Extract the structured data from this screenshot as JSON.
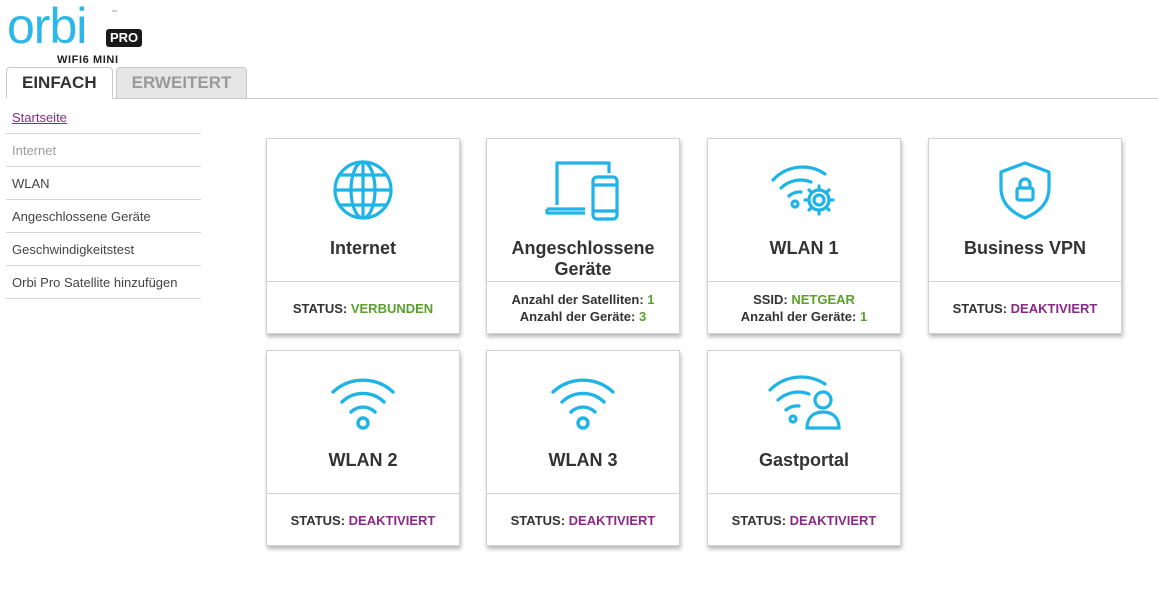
{
  "logo": {
    "word": "orbi",
    "tm": "™",
    "badge": "PRO",
    "subtitle": "WIFI6 MINI"
  },
  "tabs": [
    {
      "label": "EINFACH"
    },
    {
      "label": "ERWEITERT"
    }
  ],
  "sidebar": {
    "items": [
      {
        "label": "Startseite"
      },
      {
        "label": "Internet"
      },
      {
        "label": "WLAN"
      },
      {
        "label": "Angeschlossene Geräte"
      },
      {
        "label": "Geschwindigkeitstest"
      },
      {
        "label": "Orbi Pro Satellite hinzufügen"
      }
    ]
  },
  "colors": {
    "accent": "#1eb4e8",
    "ok": "#5aa02c",
    "off": "#8a2a88"
  },
  "tiles": [
    {
      "title": "Internet",
      "icon": "globe-icon",
      "status_label": "STATUS:",
      "status_value": "VERBUNDEN"
    },
    {
      "title": "Angeschlossene Geräte",
      "icon": "devices-icon",
      "line1_label": "Anzahl der Satelliten:",
      "line1_value": "1",
      "line2_label": "Anzahl der Geräte:",
      "line2_value": "3"
    },
    {
      "title": "WLAN 1",
      "icon": "wifi-settings-icon",
      "line1_label": "SSID:",
      "line1_value": "NETGEAR",
      "line2_label": "Anzahl der Geräte:",
      "line2_value": "1"
    },
    {
      "title": "Business VPN",
      "icon": "shield-lock-icon",
      "status_label": "STATUS:",
      "status_value": "DEAKTIVIERT"
    },
    {
      "title": "WLAN 2",
      "icon": "wifi-icon",
      "status_label": "STATUS:",
      "status_value": "DEAKTIVIERT"
    },
    {
      "title": "WLAN 3",
      "icon": "wifi-icon",
      "status_label": "STATUS:",
      "status_value": "DEAKTIVIERT"
    },
    {
      "title": "Gastportal",
      "icon": "wifi-user-icon",
      "status_label": "STATUS:",
      "status_value": "DEAKTIVIERT"
    }
  ]
}
